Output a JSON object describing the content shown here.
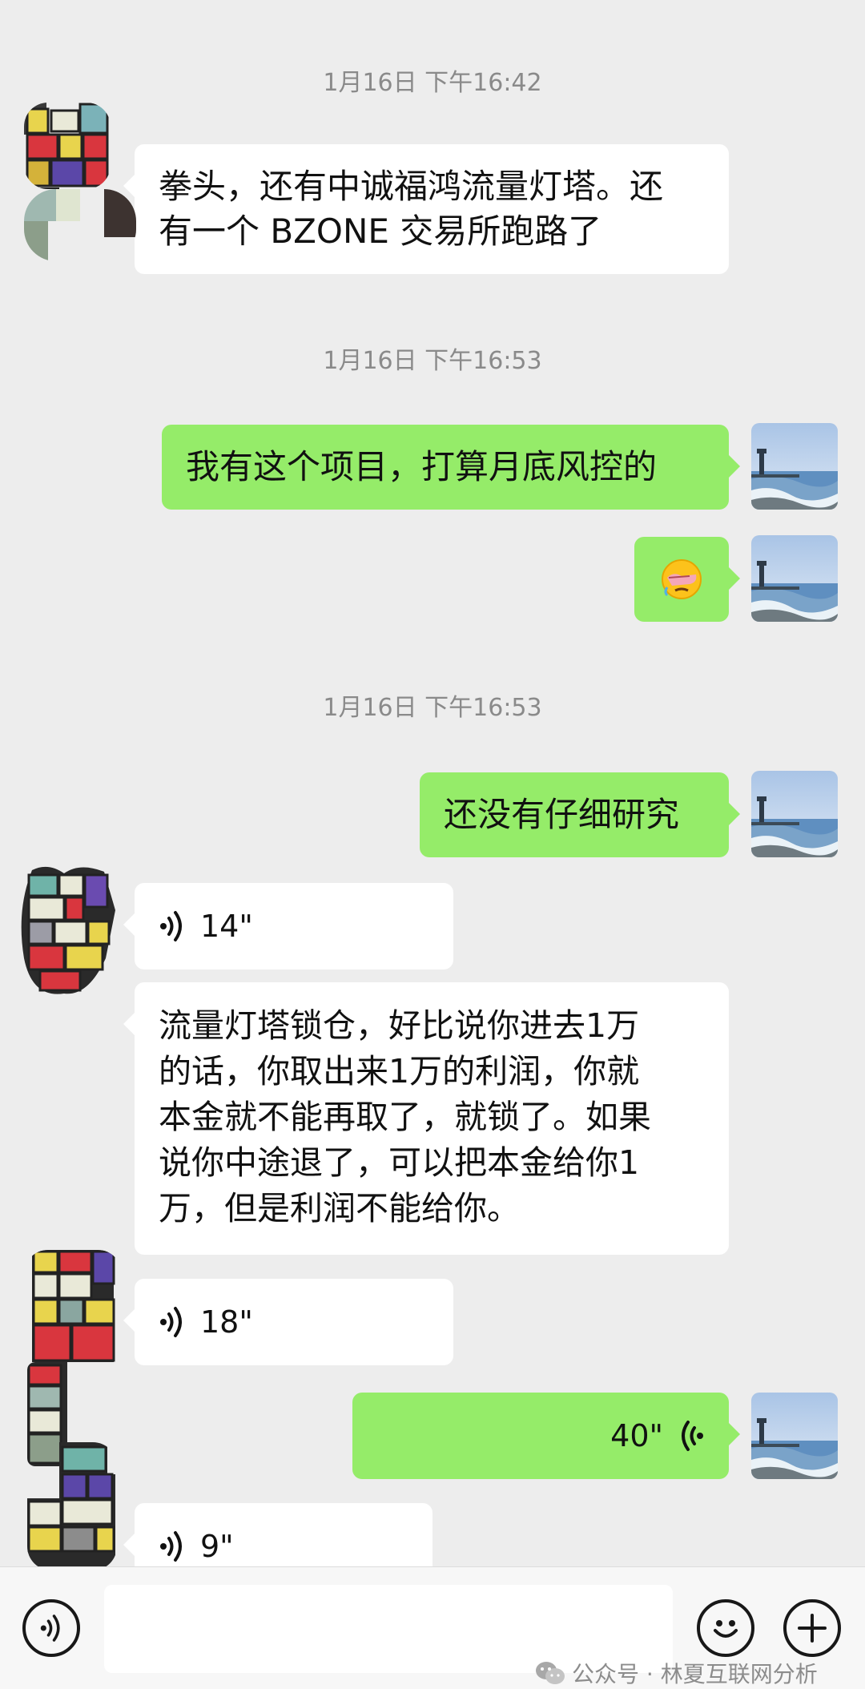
{
  "timestamps": [
    "1月16日 下午16:42",
    "1月16日 下午16:53",
    "1月16日 下午16:53"
  ],
  "messages": {
    "m1": "拳头，还有中诚福鸿流量灯塔。还有一个 BZONE 交易所跑路了",
    "m1_line1": "拳头，还有中诚福鸿流量灯塔。还",
    "m1_line2": "有一个 BZONE 交易所跑路了",
    "m2": "我有这个项目，打算月底风控的",
    "m3_emoji": "😭",
    "m4": "还没有仔细研究",
    "m5_voice": "14\"",
    "m6_line1": "流量灯塔锁仓，好比说你进去1万",
    "m6_line2": "的话，你取出来1万的利润，你就",
    "m6_line3": "本金就不能再取了，就锁了。如果",
    "m6_line4": "说你中途退了，可以把本金给你1",
    "m6_line5": "万，但是利润不能给你。",
    "m7_voice": "18\"",
    "m8_voice": "40\"",
    "m9_voice": "9\""
  },
  "watermark": "公众号 · 林夏互联网分析",
  "icons": {
    "voice_toggle": "voice-wave-icon",
    "emoji": "smile-icon",
    "more": "plus-icon",
    "wechat": "wechat-logo-icon"
  },
  "colors": {
    "background": "#ededed",
    "incoming_bubble": "#ffffff",
    "outgoing_bubble": "#95ec69",
    "timestamp": "#8a8a8a"
  }
}
